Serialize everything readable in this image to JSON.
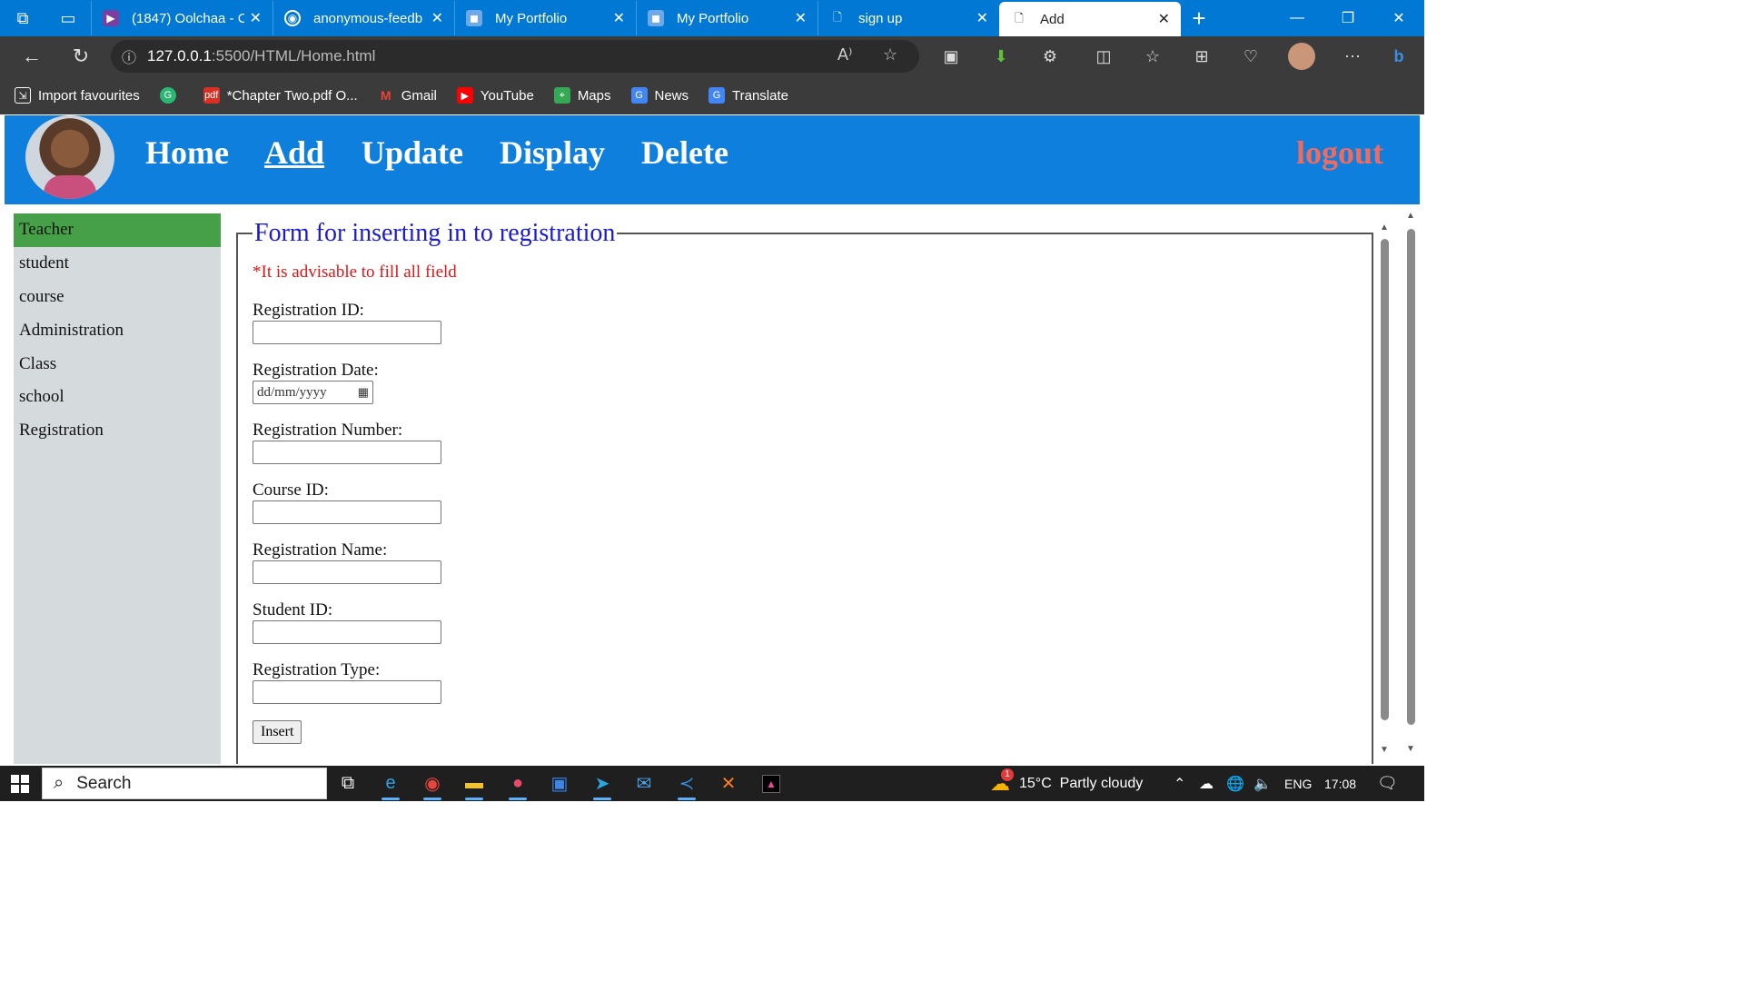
{
  "browser": {
    "tabs": [
      {
        "title": "(1847) Oolchaa - C",
        "icon": "youtube-icon"
      },
      {
        "title": "anonymous-feedb",
        "icon": "github-icon"
      },
      {
        "title": "My Portfolio",
        "icon": "page-icon"
      },
      {
        "title": "My Portfolio",
        "icon": "page-icon"
      },
      {
        "title": "sign up",
        "icon": "document-icon"
      },
      {
        "title": "Add",
        "icon": "document-icon",
        "active": true
      }
    ],
    "url_host": "127.0.0.1",
    "url_path": ":5500/HTML/Home.html",
    "bookmarks": [
      {
        "label": "Import favourites"
      },
      {
        "label": ""
      },
      {
        "label": "*Chapter Two.pdf O..."
      },
      {
        "label": "Gmail"
      },
      {
        "label": "YouTube"
      },
      {
        "label": "Maps"
      },
      {
        "label": "News"
      },
      {
        "label": "Translate"
      }
    ]
  },
  "site": {
    "nav": [
      "Home",
      "Add",
      "Update",
      "Display",
      "Delete"
    ],
    "active_nav": "Add",
    "logout": "logout",
    "sidebar": [
      "Teacher",
      "student",
      "course",
      "Administration",
      "Class",
      "school",
      "Registration"
    ],
    "active_sidebar": "Teacher"
  },
  "form": {
    "legend": "Form for inserting in to registration",
    "advice": "*It is advisable to fill all field",
    "fields": [
      {
        "label": "Registration ID:",
        "type": "text",
        "value": ""
      },
      {
        "label": "Registration Date:",
        "type": "date",
        "placeholder": "dd/mm/yyyy"
      },
      {
        "label": "Registration Number:",
        "type": "text",
        "value": ""
      },
      {
        "label": "Course ID:",
        "type": "text",
        "value": ""
      },
      {
        "label": "Registration Name:",
        "type": "text",
        "value": ""
      },
      {
        "label": "Student ID:",
        "type": "text",
        "value": ""
      },
      {
        "label": "Registration Type:",
        "type": "text",
        "value": ""
      }
    ],
    "submit": "Insert"
  },
  "taskbar": {
    "search": "Search",
    "weather": "15°C  Partly cloudy",
    "weather_badge": "1",
    "language": "ENG",
    "time": "17:08"
  },
  "colors": {
    "header": "#0f7fde",
    "sidebar": "#d5dadd",
    "sidebar_active": "#46a047",
    "legend": "#1a1ad6",
    "advice": "#e01515",
    "logout": "#f26a5d"
  }
}
